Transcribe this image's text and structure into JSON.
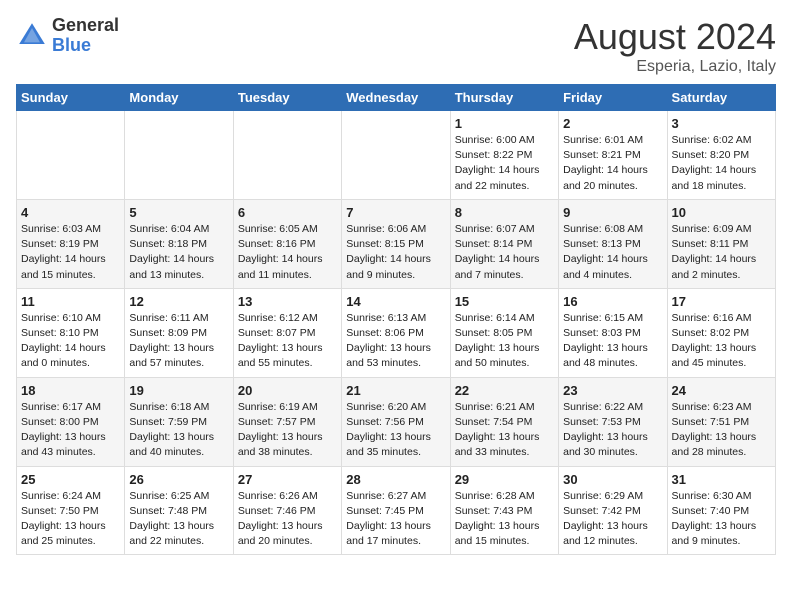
{
  "header": {
    "logo_general": "General",
    "logo_blue": "Blue",
    "month_year": "August 2024",
    "location": "Esperia, Lazio, Italy"
  },
  "weekdays": [
    "Sunday",
    "Monday",
    "Tuesday",
    "Wednesday",
    "Thursday",
    "Friday",
    "Saturday"
  ],
  "weeks": [
    [
      {
        "day": "",
        "info": ""
      },
      {
        "day": "",
        "info": ""
      },
      {
        "day": "",
        "info": ""
      },
      {
        "day": "",
        "info": ""
      },
      {
        "day": "1",
        "info": "Sunrise: 6:00 AM\nSunset: 8:22 PM\nDaylight: 14 hours\nand 22 minutes."
      },
      {
        "day": "2",
        "info": "Sunrise: 6:01 AM\nSunset: 8:21 PM\nDaylight: 14 hours\nand 20 minutes."
      },
      {
        "day": "3",
        "info": "Sunrise: 6:02 AM\nSunset: 8:20 PM\nDaylight: 14 hours\nand 18 minutes."
      }
    ],
    [
      {
        "day": "4",
        "info": "Sunrise: 6:03 AM\nSunset: 8:19 PM\nDaylight: 14 hours\nand 15 minutes."
      },
      {
        "day": "5",
        "info": "Sunrise: 6:04 AM\nSunset: 8:18 PM\nDaylight: 14 hours\nand 13 minutes."
      },
      {
        "day": "6",
        "info": "Sunrise: 6:05 AM\nSunset: 8:16 PM\nDaylight: 14 hours\nand 11 minutes."
      },
      {
        "day": "7",
        "info": "Sunrise: 6:06 AM\nSunset: 8:15 PM\nDaylight: 14 hours\nand 9 minutes."
      },
      {
        "day": "8",
        "info": "Sunrise: 6:07 AM\nSunset: 8:14 PM\nDaylight: 14 hours\nand 7 minutes."
      },
      {
        "day": "9",
        "info": "Sunrise: 6:08 AM\nSunset: 8:13 PM\nDaylight: 14 hours\nand 4 minutes."
      },
      {
        "day": "10",
        "info": "Sunrise: 6:09 AM\nSunset: 8:11 PM\nDaylight: 14 hours\nand 2 minutes."
      }
    ],
    [
      {
        "day": "11",
        "info": "Sunrise: 6:10 AM\nSunset: 8:10 PM\nDaylight: 14 hours\nand 0 minutes."
      },
      {
        "day": "12",
        "info": "Sunrise: 6:11 AM\nSunset: 8:09 PM\nDaylight: 13 hours\nand 57 minutes."
      },
      {
        "day": "13",
        "info": "Sunrise: 6:12 AM\nSunset: 8:07 PM\nDaylight: 13 hours\nand 55 minutes."
      },
      {
        "day": "14",
        "info": "Sunrise: 6:13 AM\nSunset: 8:06 PM\nDaylight: 13 hours\nand 53 minutes."
      },
      {
        "day": "15",
        "info": "Sunrise: 6:14 AM\nSunset: 8:05 PM\nDaylight: 13 hours\nand 50 minutes."
      },
      {
        "day": "16",
        "info": "Sunrise: 6:15 AM\nSunset: 8:03 PM\nDaylight: 13 hours\nand 48 minutes."
      },
      {
        "day": "17",
        "info": "Sunrise: 6:16 AM\nSunset: 8:02 PM\nDaylight: 13 hours\nand 45 minutes."
      }
    ],
    [
      {
        "day": "18",
        "info": "Sunrise: 6:17 AM\nSunset: 8:00 PM\nDaylight: 13 hours\nand 43 minutes."
      },
      {
        "day": "19",
        "info": "Sunrise: 6:18 AM\nSunset: 7:59 PM\nDaylight: 13 hours\nand 40 minutes."
      },
      {
        "day": "20",
        "info": "Sunrise: 6:19 AM\nSunset: 7:57 PM\nDaylight: 13 hours\nand 38 minutes."
      },
      {
        "day": "21",
        "info": "Sunrise: 6:20 AM\nSunset: 7:56 PM\nDaylight: 13 hours\nand 35 minutes."
      },
      {
        "day": "22",
        "info": "Sunrise: 6:21 AM\nSunset: 7:54 PM\nDaylight: 13 hours\nand 33 minutes."
      },
      {
        "day": "23",
        "info": "Sunrise: 6:22 AM\nSunset: 7:53 PM\nDaylight: 13 hours\nand 30 minutes."
      },
      {
        "day": "24",
        "info": "Sunrise: 6:23 AM\nSunset: 7:51 PM\nDaylight: 13 hours\nand 28 minutes."
      }
    ],
    [
      {
        "day": "25",
        "info": "Sunrise: 6:24 AM\nSunset: 7:50 PM\nDaylight: 13 hours\nand 25 minutes."
      },
      {
        "day": "26",
        "info": "Sunrise: 6:25 AM\nSunset: 7:48 PM\nDaylight: 13 hours\nand 22 minutes."
      },
      {
        "day": "27",
        "info": "Sunrise: 6:26 AM\nSunset: 7:46 PM\nDaylight: 13 hours\nand 20 minutes."
      },
      {
        "day": "28",
        "info": "Sunrise: 6:27 AM\nSunset: 7:45 PM\nDaylight: 13 hours\nand 17 minutes."
      },
      {
        "day": "29",
        "info": "Sunrise: 6:28 AM\nSunset: 7:43 PM\nDaylight: 13 hours\nand 15 minutes."
      },
      {
        "day": "30",
        "info": "Sunrise: 6:29 AM\nSunset: 7:42 PM\nDaylight: 13 hours\nand 12 minutes."
      },
      {
        "day": "31",
        "info": "Sunrise: 6:30 AM\nSunset: 7:40 PM\nDaylight: 13 hours\nand 9 minutes."
      }
    ]
  ]
}
